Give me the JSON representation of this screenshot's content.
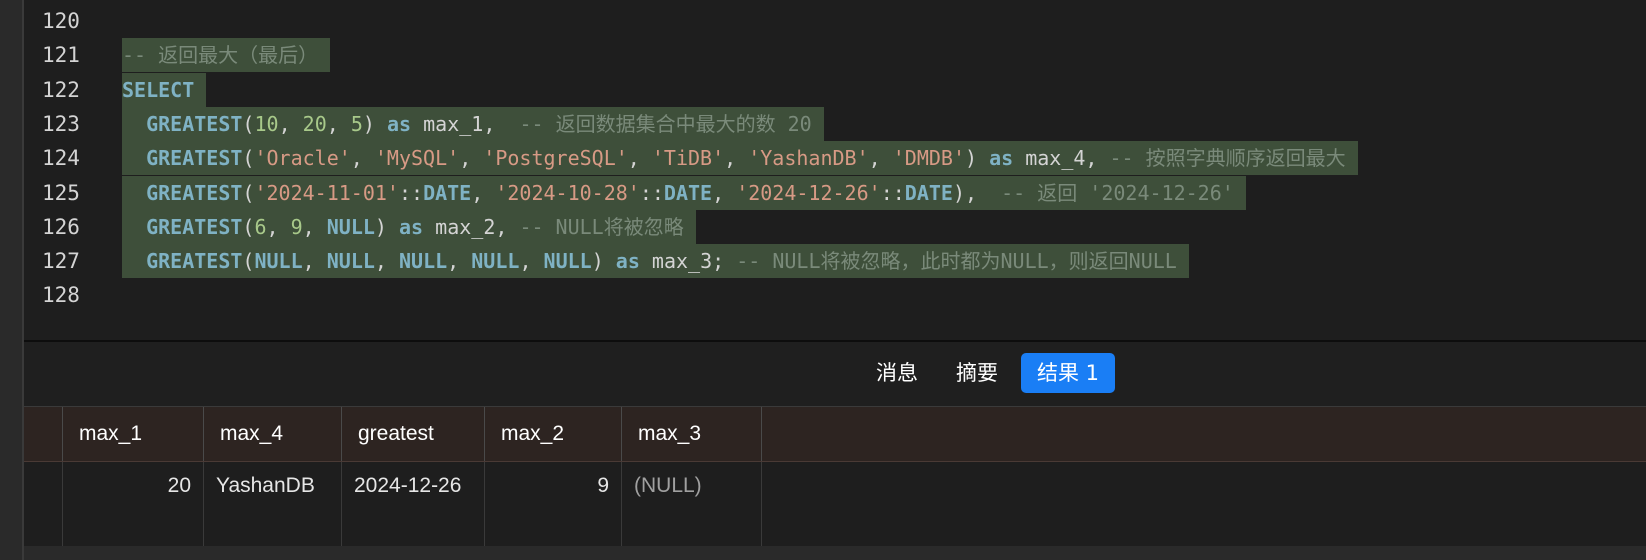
{
  "editor": {
    "line_numbers": [
      "120",
      "121",
      "122",
      "123",
      "124",
      "125",
      "126",
      "127",
      "128"
    ],
    "lines": [
      {
        "num": "121",
        "segments": [
          {
            "t": "-- 返回最大（最后）",
            "c": "cmmono"
          }
        ]
      },
      {
        "num": "122",
        "segments": [
          {
            "t": "SELECT",
            "c": "kw"
          }
        ]
      },
      {
        "num": "123",
        "segments": [
          {
            "t": "  ",
            "c": "id"
          },
          {
            "t": "GREATEST",
            "c": "fn"
          },
          {
            "t": "(",
            "c": "id"
          },
          {
            "t": "10",
            "c": "num"
          },
          {
            "t": ", ",
            "c": "id"
          },
          {
            "t": "20",
            "c": "num"
          },
          {
            "t": ", ",
            "c": "id"
          },
          {
            "t": "5",
            "c": "num"
          },
          {
            "t": ") ",
            "c": "id"
          },
          {
            "t": "as",
            "c": "kw"
          },
          {
            "t": " max_1,  ",
            "c": "id"
          },
          {
            "t": "-- 返回数据集合中最大的数 20",
            "c": "cmmono"
          }
        ]
      },
      {
        "num": "124",
        "segments": [
          {
            "t": "  ",
            "c": "id"
          },
          {
            "t": "GREATEST",
            "c": "fn"
          },
          {
            "t": "(",
            "c": "id"
          },
          {
            "t": "'Oracle'",
            "c": "str"
          },
          {
            "t": ", ",
            "c": "id"
          },
          {
            "t": "'MySQL'",
            "c": "str"
          },
          {
            "t": ", ",
            "c": "id"
          },
          {
            "t": "'PostgreSQL'",
            "c": "str"
          },
          {
            "t": ", ",
            "c": "id"
          },
          {
            "t": "'TiDB'",
            "c": "str"
          },
          {
            "t": ", ",
            "c": "id"
          },
          {
            "t": "'YashanDB'",
            "c": "str"
          },
          {
            "t": ", ",
            "c": "id"
          },
          {
            "t": "'DMDB'",
            "c": "str"
          },
          {
            "t": ") ",
            "c": "id"
          },
          {
            "t": "as",
            "c": "kw"
          },
          {
            "t": " max_4, ",
            "c": "id"
          },
          {
            "t": "-- 按照字典顺序返回最大",
            "c": "cmmono"
          }
        ]
      },
      {
        "num": "125",
        "segments": [
          {
            "t": "  ",
            "c": "id"
          },
          {
            "t": "GREATEST",
            "c": "fn"
          },
          {
            "t": "(",
            "c": "id"
          },
          {
            "t": "'2024-11-01'",
            "c": "str"
          },
          {
            "t": "::",
            "c": "id"
          },
          {
            "t": "DATE",
            "c": "kw"
          },
          {
            "t": ", ",
            "c": "id"
          },
          {
            "t": "'2024-10-28'",
            "c": "str"
          },
          {
            "t": "::",
            "c": "id"
          },
          {
            "t": "DATE",
            "c": "kw"
          },
          {
            "t": ", ",
            "c": "id"
          },
          {
            "t": "'2024-12-26'",
            "c": "str"
          },
          {
            "t": "::",
            "c": "id"
          },
          {
            "t": "DATE",
            "c": "kw"
          },
          {
            "t": "),  ",
            "c": "id"
          },
          {
            "t": "-- 返回 '2024-12-26'",
            "c": "cmmono"
          }
        ]
      },
      {
        "num": "126",
        "segments": [
          {
            "t": "  ",
            "c": "id"
          },
          {
            "t": "GREATEST",
            "c": "fn"
          },
          {
            "t": "(",
            "c": "id"
          },
          {
            "t": "6",
            "c": "num"
          },
          {
            "t": ", ",
            "c": "id"
          },
          {
            "t": "9",
            "c": "num"
          },
          {
            "t": ", ",
            "c": "id"
          },
          {
            "t": "NULL",
            "c": "kw"
          },
          {
            "t": ") ",
            "c": "id"
          },
          {
            "t": "as",
            "c": "kw"
          },
          {
            "t": " max_2, ",
            "c": "id"
          },
          {
            "t": "-- NULL将被忽略",
            "c": "cmmono"
          }
        ]
      },
      {
        "num": "127",
        "segments": [
          {
            "t": "  ",
            "c": "id"
          },
          {
            "t": "GREATEST",
            "c": "fn"
          },
          {
            "t": "(",
            "c": "id"
          },
          {
            "t": "NULL",
            "c": "kw"
          },
          {
            "t": ", ",
            "c": "id"
          },
          {
            "t": "NULL",
            "c": "kw"
          },
          {
            "t": ", ",
            "c": "id"
          },
          {
            "t": "NULL",
            "c": "kw"
          },
          {
            "t": ", ",
            "c": "id"
          },
          {
            "t": "NULL",
            "c": "kw"
          },
          {
            "t": ", ",
            "c": "id"
          },
          {
            "t": "NULL",
            "c": "kw"
          },
          {
            "t": ") ",
            "c": "id"
          },
          {
            "t": "as",
            "c": "kw"
          },
          {
            "t": " max_3; ",
            "c": "id"
          },
          {
            "t": "-- NULL将被忽略，此时都为NULL，则返回NULL",
            "c": "cmmono"
          }
        ]
      }
    ]
  },
  "tabs": [
    {
      "label": "消息",
      "active": false
    },
    {
      "label": "摘要",
      "active": false
    },
    {
      "label": "结果 1",
      "active": true
    }
  ],
  "results": {
    "columns": [
      "max_1",
      "max_4",
      "greatest",
      "max_2",
      "max_3"
    ],
    "rows": [
      [
        "20",
        "YashanDB",
        "2024-12-26",
        "9",
        "(NULL)"
      ]
    ]
  },
  "colors": {
    "accent": "#1a7ef5",
    "selection": "#3e4f3a",
    "header_bg": "#2d2421"
  }
}
